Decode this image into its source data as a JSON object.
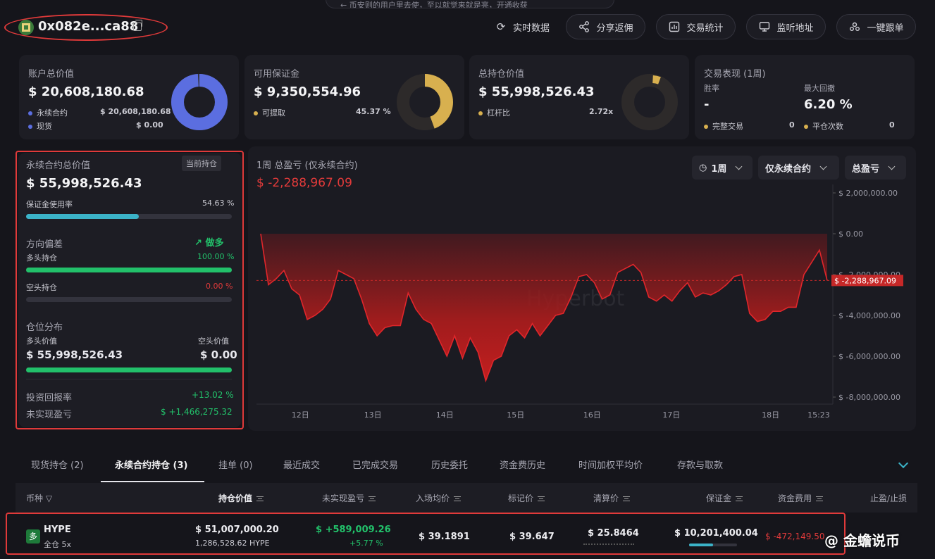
{
  "banner": {
    "text": "← 币安则的用户里去使，至以就觉来就是亮，开通收获"
  },
  "header": {
    "address": "0x082e...ca88",
    "buttons": {
      "realtime": "实时数据",
      "share": "分享返佣",
      "stats": "交易统计",
      "monitor": "监听地址",
      "copy_trade": "一键跟单"
    }
  },
  "cards": {
    "account": {
      "title": "账户总价值",
      "value": "$ 20,608,180.68",
      "perp_label": "永续合约",
      "perp_value": "$ 20,608,180.68",
      "spot_label": "现货",
      "spot_value": "$ 0.00",
      "perp_share": 1.0,
      "color": "#5b6ee0"
    },
    "margin": {
      "title": "可用保证金",
      "value": "$ 9,350,554.96",
      "withdraw_label": "可提取",
      "withdraw_value": "45.37 %",
      "withdraw_share": 0.4537,
      "color": "#d8b04f"
    },
    "position": {
      "title": "总持仓价值",
      "value": "$ 55,998,526.43",
      "leverage_label": "杠杆比",
      "leverage_value": "2.72x",
      "color": "#d8b04f"
    },
    "performance": {
      "title": "交易表现 (1周)",
      "winrate_label": "胜率",
      "winrate_value": "-",
      "drawdown_label": "最大回撤",
      "drawdown_value": "6.20 %",
      "completed_label": "完整交易",
      "completed_value": "0",
      "close_label": "平仓次数",
      "close_value": "0"
    }
  },
  "perp": {
    "title": "永续合约总价值",
    "badge": "当前持仓",
    "value": "$ 55,998,526.43",
    "margin_usage_label": "保证金使用率",
    "margin_usage_value": "54.63 %",
    "margin_usage": 0.5463,
    "direction_label": "方向偏差",
    "direction_value": "做多",
    "long_label": "多头持仓",
    "long_value": "100.00 %",
    "long_share": 1.0,
    "short_label": "空头持仓",
    "short_value": "0.00 %",
    "short_share": 0.0,
    "dist_label": "仓位分布",
    "long_val_label": "多头价值",
    "short_val_label": "空头价值",
    "long_val": "$ 55,998,526.43",
    "short_val": "$ 0.00",
    "dist_share": 1.0,
    "roi_label": "投资回报率",
    "roi_value": "+13.02 %",
    "upnl_label": "未实现盈亏",
    "upnl_value": "$ +1,466,275.32"
  },
  "chart": {
    "title": "1周 总盈亏 (仅永续合约)",
    "value": "$ -2,288,967.09",
    "selectors": {
      "period": "1周",
      "scope": "仅永续合约",
      "metric": "总盈亏"
    },
    "watermark": "Hyperbot"
  },
  "chart_data": {
    "type": "area",
    "ylim": [
      -8000000,
      2000000
    ],
    "y_ticks": [
      2000000,
      0,
      -2000000,
      -4000000,
      -6000000,
      -8000000
    ],
    "y_tick_labels": [
      "$ 2,000,000.00",
      "$ 0.00",
      "$ -2,000,000.00",
      "$ -4,000,000.00",
      "$ -6,000,000.00",
      "$ -8,000,000.00"
    ],
    "x_tick_labels": [
      "12日",
      "13日",
      "14日",
      "15日",
      "16日",
      "17日",
      "18日",
      "15:23"
    ],
    "x_tick_pos": [
      0.07,
      0.198,
      0.325,
      0.45,
      0.585,
      0.725,
      0.9,
      0.985
    ],
    "current_label": "$ -2,288,967.09",
    "current_value": -2288967.09,
    "series": [
      {
        "values": [
          0,
          -2500000,
          -2200000,
          -1800000,
          -2700000,
          -3000000,
          -4200000,
          -4000000,
          -3700000,
          -3200000,
          -1800000,
          -2000000,
          -2200000,
          -3200000,
          -4400000,
          -5000000,
          -4600000,
          -4500000,
          -4500000,
          -2900000,
          -3700000,
          -4200000,
          -4400000,
          -5200000,
          -6000000,
          -5000000,
          -6100000,
          -5100000,
          -5800000,
          -7200000,
          -6200000,
          -6000000,
          -5000000,
          -4700000,
          -5100000,
          -4400000,
          -5000000,
          -4500000,
          -4000000,
          -3900000,
          -3100000,
          -2100000,
          -2000000,
          -2400000,
          -3200000,
          -3000000,
          -1900000,
          -1700000,
          -1500000,
          -1900000,
          -3100000,
          -3300000,
          -3000000,
          -3300000,
          -2800000,
          -2400000,
          -3100000,
          -2900000,
          -3000000,
          -2800000,
          -2500000,
          -2100000,
          -2000000,
          -3900000,
          -4300000,
          -4200000,
          -3800000,
          -3800000,
          -3600000,
          -3600000,
          -2000000,
          -1400000,
          -800000,
          -2288967
        ]
      }
    ]
  },
  "tabs": [
    "现货持仓 (2)",
    "永续合约持仓 (3)",
    "挂单 (0)",
    "最近成交",
    "已完成交易",
    "历史委托",
    "资金费历史",
    "时间加权平均价",
    "存款与取款"
  ],
  "table": {
    "headers": [
      "币种",
      "持仓价值",
      "未实现盈亏",
      "入场均价",
      "标记价",
      "清算价",
      "保证金",
      "资金费用",
      "止盈/止损"
    ],
    "row": {
      "side": "多",
      "coin": "HYPE",
      "mode": "全仓 5x",
      "value": "$ 51,007,000.20",
      "qty": "1,286,528.62 HYPE",
      "upnl": "$ +589,009.26",
      "upnl_pct": "+5.77 %",
      "entry": "$ 39.1891",
      "mark": "$ 39.647",
      "liq": "$ 25.8464",
      "margin": "$ 10,201,400.04",
      "funding": "$ -472,149.50",
      "margin_share": 0.5
    }
  },
  "watermark": "@ 金蟾说币"
}
